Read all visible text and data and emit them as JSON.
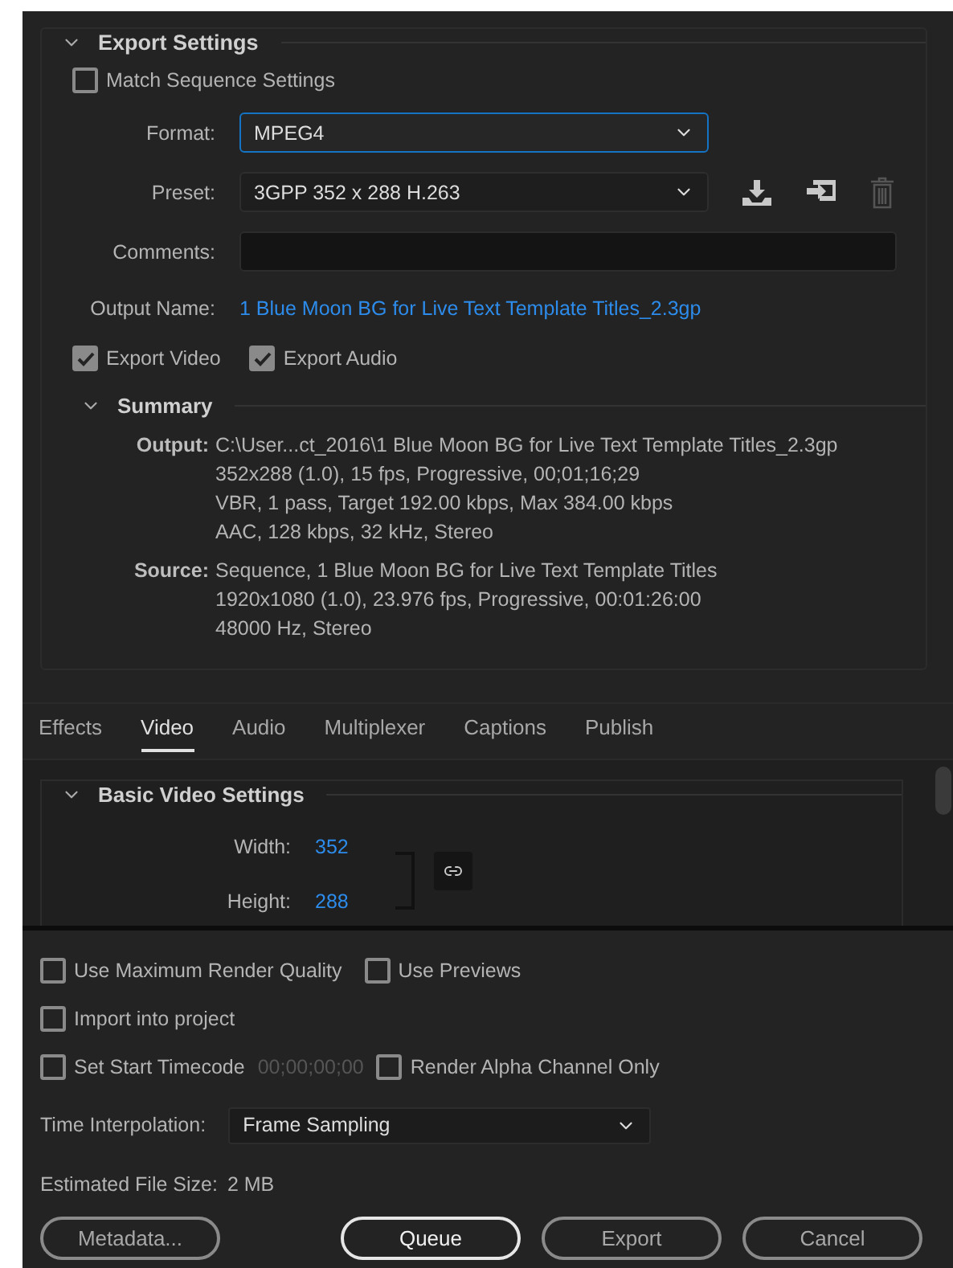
{
  "export_settings": {
    "title": "Export Settings",
    "expanded": true,
    "match_sequence": {
      "label": "Match Sequence Settings",
      "checked": false
    },
    "format": {
      "label": "Format:",
      "value": "MPEG4"
    },
    "preset": {
      "label": "Preset:",
      "value": "3GPP 352 x 288 H.263"
    },
    "comments": {
      "label": "Comments:"
    },
    "output_name": {
      "label": "Output Name:",
      "value": "1 Blue Moon BG for Live Text Template Titles_2.3gp"
    },
    "exports": [
      {
        "label": "Export Video",
        "checked": true
      },
      {
        "label": "Export Audio",
        "checked": true
      }
    ],
    "summary": {
      "title": "Summary",
      "expanded": true,
      "groups": [
        {
          "label": "Output:",
          "lines": [
            "C:\\User...ct_2016\\1 Blue Moon BG for Live Text Template Titles_2.3gp",
            "352x288 (1.0), 15 fps, Progressive, 00;01;16;29",
            "VBR, 1 pass, Target 192.00 kbps, Max 384.00 kbps",
            "AAC, 128 kbps, 32 kHz, Stereo"
          ]
        },
        {
          "label": "Source:",
          "lines": [
            "Sequence, 1 Blue Moon BG for Live Text Template Titles",
            "1920x1080 (1.0), 23.976 fps, Progressive, 00:01:26:00",
            "48000 Hz, Stereo"
          ]
        }
      ]
    }
  },
  "tabs": [
    {
      "label": "Effects",
      "selected": false
    },
    {
      "label": "Video",
      "selected": true
    },
    {
      "label": "Audio",
      "selected": false
    },
    {
      "label": "Multiplexer",
      "selected": false
    },
    {
      "label": "Captions",
      "selected": false
    },
    {
      "label": "Publish",
      "selected": false
    }
  ],
  "basic_video": {
    "title": "Basic Video Settings",
    "expanded": true,
    "width": {
      "label": "Width:",
      "value": "352"
    },
    "height": {
      "label": "Height:",
      "value": "288"
    }
  },
  "option_rows": [
    {
      "items": [
        {
          "kind": "checkbox",
          "label": "Use Maximum Render Quality",
          "checked": false
        },
        {
          "kind": "checkbox",
          "label": "Use Previews",
          "checked": false
        }
      ]
    },
    {
      "items": [
        {
          "kind": "checkbox",
          "label": "Import into project",
          "checked": false
        }
      ]
    },
    {
      "items": [
        {
          "kind": "checkbox",
          "label": "Set Start Timecode",
          "checked": false
        },
        {
          "kind": "timecode",
          "value": "00;00;00;00"
        },
        {
          "kind": "checkbox",
          "label": "Render Alpha Channel Only",
          "checked": false
        }
      ]
    }
  ],
  "time_interpolation": {
    "label": "Time Interpolation:",
    "value": "Frame Sampling"
  },
  "estimated_size": {
    "label": "Estimated File Size:",
    "value": "2 MB"
  },
  "buttons": [
    {
      "label": "Metadata...",
      "focused": false
    },
    {
      "label": "Queue",
      "focused": true
    },
    {
      "label": "Export",
      "focused": false
    },
    {
      "label": "Cancel",
      "focused": false
    }
  ]
}
